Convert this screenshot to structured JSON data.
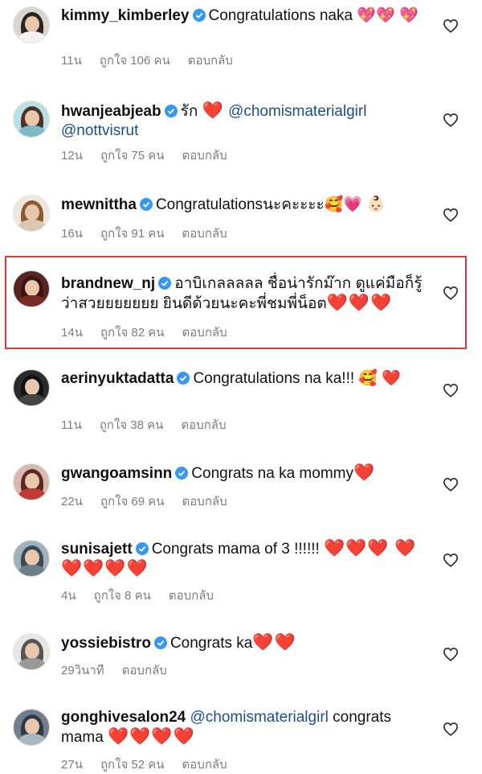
{
  "comments": [
    {
      "username": "kimmy_kimberley",
      "verified": true,
      "text": "Congratulations naka",
      "emoji": "💖💖 💖",
      "time": "11น",
      "likes": "ถูกใจ 106 คน",
      "reply": "ตอบกลับ"
    },
    {
      "username": "hwanjeabjeab",
      "verified": true,
      "text": "รัก",
      "emoji": "❤️",
      "mention1": "@chomismaterialgirl",
      "mention2": "@nottvisrut",
      "time": "12น",
      "likes": "ถูกใจ 75 คน",
      "reply": "ตอบกลับ"
    },
    {
      "username": "mewnittha",
      "verified": true,
      "text": "Congratulationsนะคะะะะ",
      "emoji": "🥰💗 👶🏻",
      "time": "16น",
      "likes": "ถูกใจ 91 คน",
      "reply": "ตอบกลับ"
    },
    {
      "username": "brandnew_nj",
      "verified": true,
      "text": "อาบิเกลลลลล ชื่อน่ารักม๊าก ดูแค่มือก็รู้ว่าสวยยยยยยย ยินดีด้วยนะคะพี่ชมพี่น็อต",
      "emoji": "❤️❤️❤️",
      "time": "14น",
      "likes": "ถูกใจ 82 คน",
      "reply": "ตอบกลับ"
    },
    {
      "username": "aerinyuktadatta",
      "verified": true,
      "text": "Congratulations na ka!!!",
      "emoji": "🥰 ❤️",
      "time": "11น",
      "likes": "ถูกใจ 38 คน",
      "reply": "ตอบกลับ"
    },
    {
      "username": "gwangoamsinn",
      "verified": true,
      "text": "Congrats na ka mommy",
      "emoji": "❤️",
      "time": "22น",
      "likes": "ถูกใจ 69 คน",
      "reply": "ตอบกลับ"
    },
    {
      "username": "sunisajett",
      "verified": true,
      "text": "Congrats mama of 3 !!!!!!",
      "emoji": "❤️❤️❤️ ❤️❤️❤️❤️❤️",
      "time": "4น",
      "likes": "ถูกใจ 8 คน",
      "reply": "ตอบกลับ"
    },
    {
      "username": "yossiebistro",
      "verified": true,
      "text": "Congrats ka",
      "emoji": "❤️❤️",
      "time": "29วินาที",
      "likes": "",
      "reply": "ตอบกลับ"
    },
    {
      "username": "gonghivesalon24",
      "verified": false,
      "text": "congrats mama",
      "emoji": "❤️❤️❤️❤️",
      "mention1": "@chomismaterialgirl",
      "time": "27น",
      "likes": "ถูกใจ 52 คน",
      "reply": "ตอบกลับ"
    }
  ],
  "colors": {
    "mention": "#1a4d8f",
    "meta": "#7c7c7c",
    "verified": "#3897f0",
    "highlight": "#d43a3a"
  },
  "icons": {
    "like": "heart-outline-icon",
    "verified": "verified-badge-icon"
  }
}
